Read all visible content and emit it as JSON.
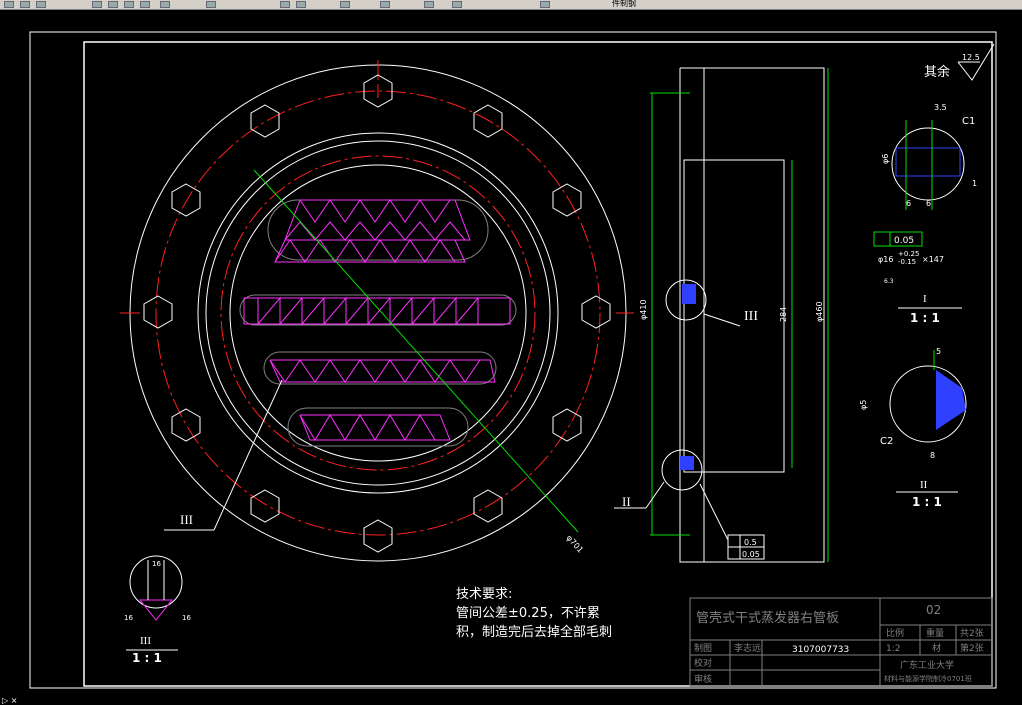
{
  "toolbar": {
    "file_label": "件制钢",
    "icons": [
      "open-icon",
      "save-icon",
      "print-icon",
      "cut-icon",
      "copy-icon",
      "paste-icon",
      "undo-icon",
      "redo-icon",
      "pan-icon",
      "zoom-icon",
      "zoom-window-icon",
      "properties-icon",
      "layer-icon",
      "text-style-icon",
      "dim-style-icon",
      "help-icon"
    ]
  },
  "drawing": {
    "roughness_other": "其余",
    "roughness_value": "12.5",
    "detail_I": "I",
    "detail_I_scale": "1 : 1",
    "detail_II": "II",
    "detail_II_scale": "1 : 1",
    "detail_III": "III",
    "detail_III_scale": "1 : 1",
    "callout_III_front": "III",
    "callout_III_side": "III",
    "callout_II_side": "II",
    "dim_side_410": "φ410",
    "dim_side_284": "284",
    "dim_side_460": "φ460",
    "dim_diag": "φ701",
    "dim_d1_35": "3.5",
    "dim_d1_c1": "C1",
    "dim_d1_phi6": "φ6",
    "dim_d1_6a": "6",
    "dim_d1_6b": "6",
    "dim_d1_1": "1",
    "dim_d1_tol": "0.05",
    "dim_d1_hole": "φ16",
    "dim_d1_hole_upper": "+0.25",
    "dim_d1_hole_lower": "-0.15",
    "dim_d1_hole_count": "×147",
    "dim_d1_rough": "6.3",
    "dim_d2_5": "5",
    "dim_d2_phi5": "φ5",
    "dim_d2_c2": "C2",
    "dim_d2_8": "8",
    "dim_d3_16": "16",
    "dim_d3_a": "16",
    "dim_d3_b": "16",
    "tol_flat": "0.5",
    "tol_pos": "0.05",
    "notes_title": "技术要求:",
    "notes_line1": "管间公差±0.25，不许累",
    "notes_line2": "积，制造完后去掉全部毛刺"
  },
  "title_block": {
    "part_name": "管壳式干式蒸发器右管板",
    "drawing_no": "02",
    "row_drawn": "制图",
    "drawn_by": "李志远",
    "student_id": "3107007733",
    "row_check": "校对",
    "row_review": "审核",
    "scale_label": "比例",
    "qty_label": "重量",
    "sheet_label": "共2张",
    "scale_value": "1:2",
    "mat_value": "材",
    "sheet_no": "第2张",
    "school": "广东工业大学",
    "dept": "材料与能源学院制冷0701班"
  },
  "colors": {
    "line": "#ffffff",
    "red": "#ff2020",
    "green": "#00e000",
    "magenta": "#ff30ff",
    "blue": "#3040ff",
    "gray": "#808080",
    "dim": "#ffffff"
  }
}
